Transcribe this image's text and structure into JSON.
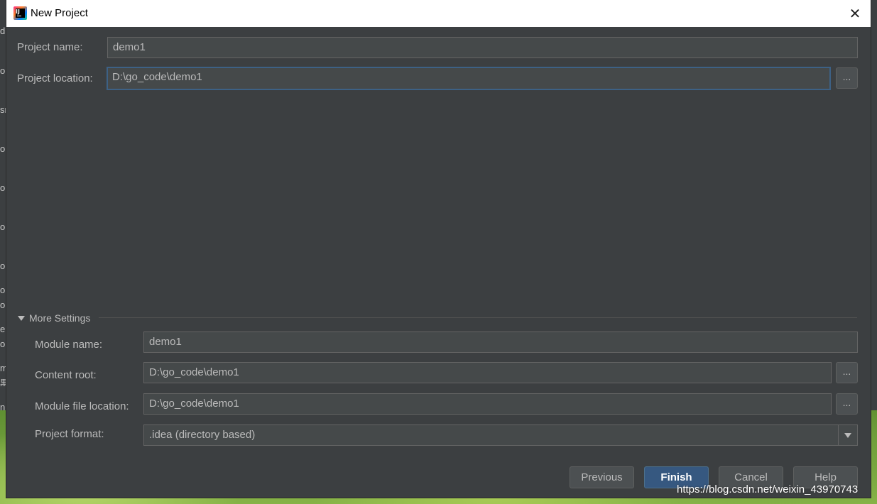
{
  "background": {
    "left_fragments": [
      "d",
      "o",
      "sr",
      "o",
      "o",
      "o",
      "o",
      "o",
      "o",
      "er",
      "o",
      "m",
      "黒",
      "n"
    ]
  },
  "dialog": {
    "title": "New Project",
    "close_glyph": "✕"
  },
  "form": {
    "project_name_label": "Project name:",
    "project_name_value": "demo1",
    "project_location_label": "Project location:",
    "project_location_value": "D:\\go_code\\demo1",
    "browse_label": "..."
  },
  "more_settings": {
    "toggle_label": "More Settings",
    "module_name_label": "Module name:",
    "module_name_value": "demo1",
    "content_root_label": "Content root:",
    "content_root_value": "D:\\go_code\\demo1",
    "module_file_location_label": "Module file location:",
    "module_file_location_value": "D:\\go_code\\demo1",
    "project_format_label": "Project format:",
    "project_format_value": ".idea (directory based)"
  },
  "buttons": {
    "previous": "Previous",
    "finish": "Finish",
    "cancel": "Cancel",
    "help": "Help"
  },
  "watermark": "https://blog.csdn.net/weixin_43970743",
  "colors": {
    "dialog_bg": "#3c3f41",
    "field_bg": "#45494a",
    "focus_border": "#3d6185",
    "primary_button": "#365880",
    "text": "#bbbbbb"
  }
}
